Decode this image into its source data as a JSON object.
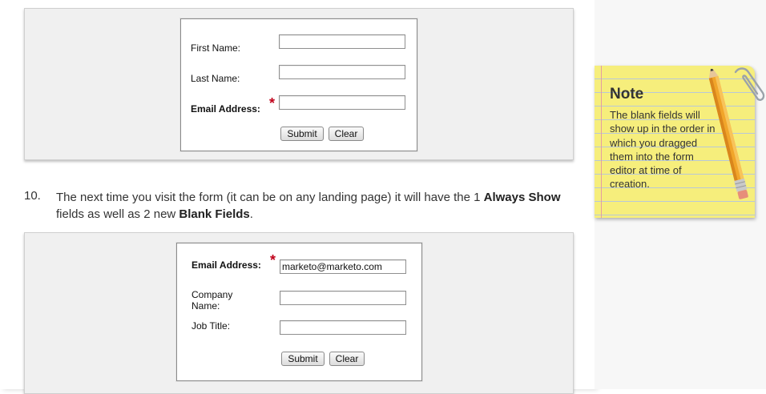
{
  "form1": {
    "first_name_label": "First Name:",
    "last_name_label": "Last Name:",
    "email_label": "Email Address:",
    "required_mark": "*",
    "first_name_value": "",
    "last_name_value": "",
    "email_value": "",
    "submit_label": "Submit",
    "clear_label": "Clear"
  },
  "step": {
    "number": "10.",
    "text_1": "The next time you visit the form (it can be on any landing page) it will have the 1 ",
    "bold_1": "Always Show",
    "text_2": " fields as well as 2 new ",
    "bold_2": "Blank Fields",
    "text_3": "."
  },
  "form2": {
    "email_label": "Email Address:",
    "required_mark": "*",
    "email_value": "marketo@marketo.com",
    "company_label_line1": "Company",
    "company_label_line2": "Name:",
    "job_title_label": "Job Title:",
    "company_value": "",
    "job_title_value": "",
    "submit_label": "Submit",
    "clear_label": "Clear"
  },
  "note": {
    "title": "Note",
    "body": "The blank fields will show up in the order in which you dragged them into the form editor at time of creation.",
    "pencil_icon": "pencil-icon",
    "clip_icon": "paperclip-icon",
    "paper_color": "#f6ee7c"
  },
  "colors": {
    "required": "#c0001a",
    "screenshot_bg": "#f0f0f0"
  }
}
